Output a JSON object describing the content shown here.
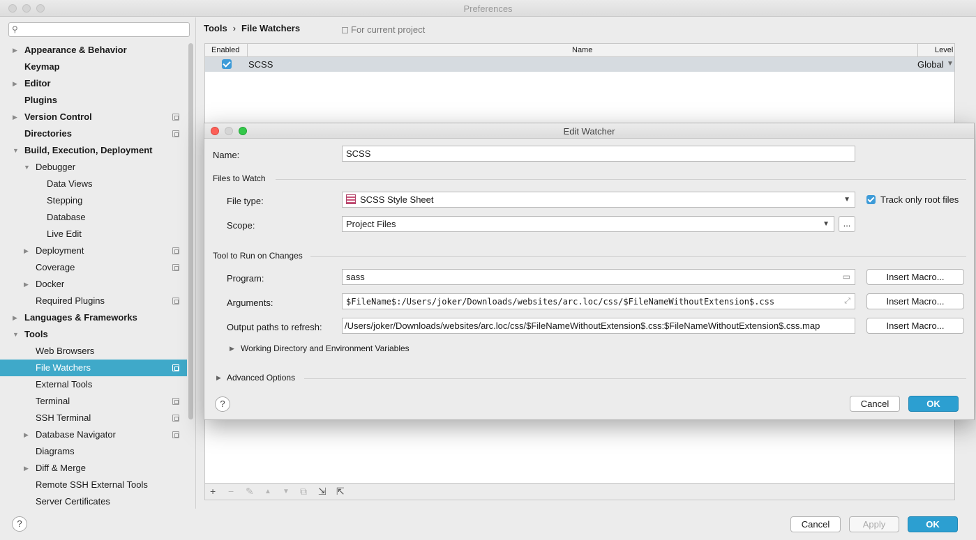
{
  "window": {
    "title": "Preferences"
  },
  "sidebar": {
    "search_placeholder": "",
    "items": [
      {
        "label": "Appearance & Behavior",
        "bold": true,
        "level": 0,
        "arrow": true
      },
      {
        "label": "Keymap",
        "bold": true,
        "level": 0,
        "arrow": false
      },
      {
        "label": "Editor",
        "bold": true,
        "level": 0,
        "arrow": true
      },
      {
        "label": "Plugins",
        "bold": true,
        "level": 0,
        "arrow": false
      },
      {
        "label": "Version Control",
        "bold": true,
        "level": 0,
        "arrow": true,
        "project_icon": true
      },
      {
        "label": "Directories",
        "bold": true,
        "level": 0,
        "arrow": false,
        "project_icon": true
      },
      {
        "label": "Build, Execution, Deployment",
        "bold": true,
        "level": 0,
        "arrow": "open"
      },
      {
        "label": "Debugger",
        "bold": false,
        "level": 1,
        "arrow": "open"
      },
      {
        "label": "Data Views",
        "bold": false,
        "level": 2,
        "arrow": false
      },
      {
        "label": "Stepping",
        "bold": false,
        "level": 2,
        "arrow": false
      },
      {
        "label": "Database",
        "bold": false,
        "level": 2,
        "arrow": false
      },
      {
        "label": "Live Edit",
        "bold": false,
        "level": 2,
        "arrow": false
      },
      {
        "label": "Deployment",
        "bold": false,
        "level": 1,
        "arrow": true,
        "project_icon": true
      },
      {
        "label": "Coverage",
        "bold": false,
        "level": 1,
        "arrow": false,
        "project_icon": true
      },
      {
        "label": "Docker",
        "bold": false,
        "level": 1,
        "arrow": true
      },
      {
        "label": "Required Plugins",
        "bold": false,
        "level": 1,
        "arrow": false,
        "project_icon": true
      },
      {
        "label": "Languages & Frameworks",
        "bold": true,
        "level": 0,
        "arrow": true
      },
      {
        "label": "Tools",
        "bold": true,
        "level": 0,
        "arrow": "open"
      },
      {
        "label": "Web Browsers",
        "bold": false,
        "level": 1,
        "arrow": false
      },
      {
        "label": "File Watchers",
        "bold": false,
        "level": 1,
        "arrow": false,
        "project_icon": true,
        "selected": true
      },
      {
        "label": "External Tools",
        "bold": false,
        "level": 1,
        "arrow": false
      },
      {
        "label": "Terminal",
        "bold": false,
        "level": 1,
        "arrow": false,
        "project_icon": true
      },
      {
        "label": "SSH Terminal",
        "bold": false,
        "level": 1,
        "arrow": false,
        "project_icon": true
      },
      {
        "label": "Database Navigator",
        "bold": false,
        "level": 1,
        "arrow": true,
        "project_icon": true
      },
      {
        "label": "Diagrams",
        "bold": false,
        "level": 1,
        "arrow": false
      },
      {
        "label": "Diff & Merge",
        "bold": false,
        "level": 1,
        "arrow": true
      },
      {
        "label": "Remote SSH External Tools",
        "bold": false,
        "level": 1,
        "arrow": false
      },
      {
        "label": "Server Certificates",
        "bold": false,
        "level": 1,
        "arrow": false
      }
    ]
  },
  "main": {
    "breadcrumb": {
      "parent": "Tools",
      "sep": "›",
      "current": "File Watchers"
    },
    "for_project": "For current project",
    "table": {
      "headers": {
        "enabled": "Enabled",
        "name": "Name",
        "level": "Level"
      },
      "rows": [
        {
          "enabled": true,
          "name": "SCSS",
          "level": "Global"
        }
      ]
    },
    "toolbar": {
      "add": "+",
      "remove": "−",
      "edit": "✎",
      "up": "▲",
      "down": "▼",
      "copy": "⧉",
      "import": "⇲",
      "export": "⇱"
    }
  },
  "dialog": {
    "title": "Edit Watcher",
    "name_label": "Name:",
    "name_value": "SCSS",
    "files_to_watch": "Files to Watch",
    "file_type_label": "File type:",
    "file_type_value": "SCSS Style Sheet",
    "track_root_label": "Track only root files",
    "track_root_checked": true,
    "scope_label": "Scope:",
    "scope_value": "Project Files",
    "scope_more": "...",
    "tool_section": "Tool to Run on Changes",
    "program_label": "Program:",
    "program_value": "sass",
    "arguments_label": "Arguments:",
    "arguments_value": "$FileName$:/Users/joker/Downloads/websites/arc.loc/css/$FileNameWithoutExtension$.css",
    "output_label": "Output paths to refresh:",
    "output_value": "/Users/joker/Downloads/websites/arc.loc/css/$FileNameWithoutExtension$.css:$FileNameWithoutExtension$.css.map",
    "insert_macro": "Insert Macro...",
    "working_dir": "Working Directory and Environment Variables",
    "advanced": "Advanced Options",
    "help": "?",
    "cancel": "Cancel",
    "ok": "OK"
  },
  "footer": {
    "help": "?",
    "cancel": "Cancel",
    "apply": "Apply",
    "ok": "OK"
  }
}
